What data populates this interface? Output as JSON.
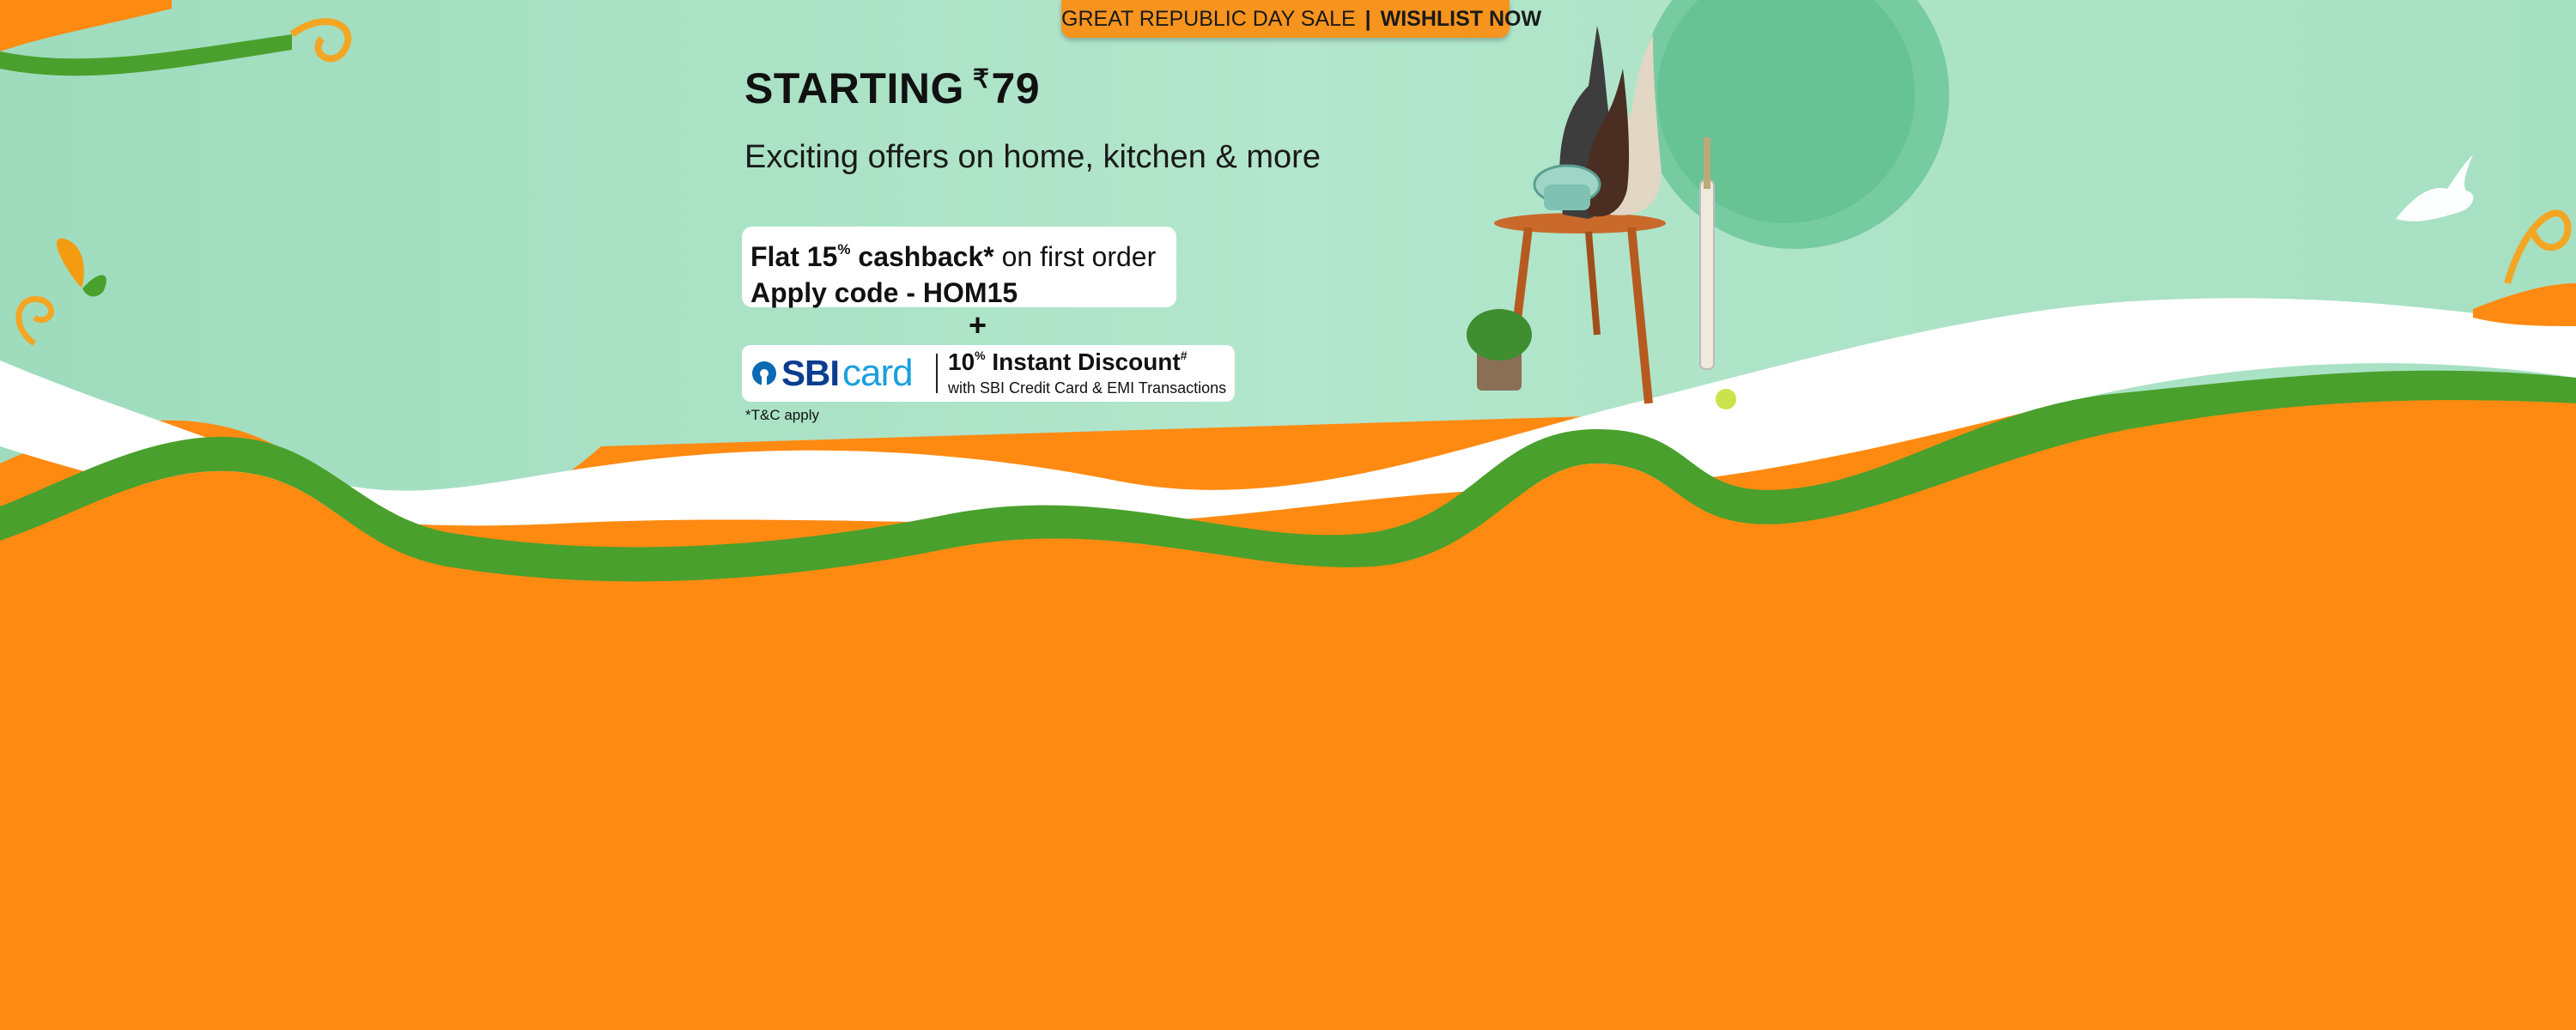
{
  "banner": {
    "sale_label": "GREAT REPUBLIC DAY SALE",
    "separator": "|",
    "cta_label": "WISHLIST NOW",
    "headline_prefix": "STARTING",
    "currency_symbol": "₹",
    "headline_price": "79",
    "subheadline": "Exciting offers on home, kitchen & more",
    "cashback": {
      "line1_bold": "Flat 15",
      "line1_sup": "%",
      "line1_bold2": " cashback*",
      "line1_rest": " on first order",
      "line2": "Apply code - HOM15"
    },
    "plus": "+",
    "bank_offer": {
      "logo_sbi": "SBI",
      "logo_card": "card",
      "discount_value": "10",
      "discount_sup": "%",
      "discount_label": " Instant Discount",
      "discount_mark": "#",
      "discount_sub": "with SBI Credit Card & EMI Transactions"
    },
    "terms": "*T&C apply"
  },
  "colors": {
    "saffron": "#ff8a12",
    "green_band": "#4aa02c",
    "mint_bg": "#a9e3c6",
    "tab_orange": "#f7941e",
    "sbi_blue": "#0a3d8f",
    "sbi_light_blue": "#1aa0dd"
  },
  "icons": [
    "butterfly-icon",
    "dove-icon",
    "swirl-icon",
    "sbi-logo-icon"
  ]
}
